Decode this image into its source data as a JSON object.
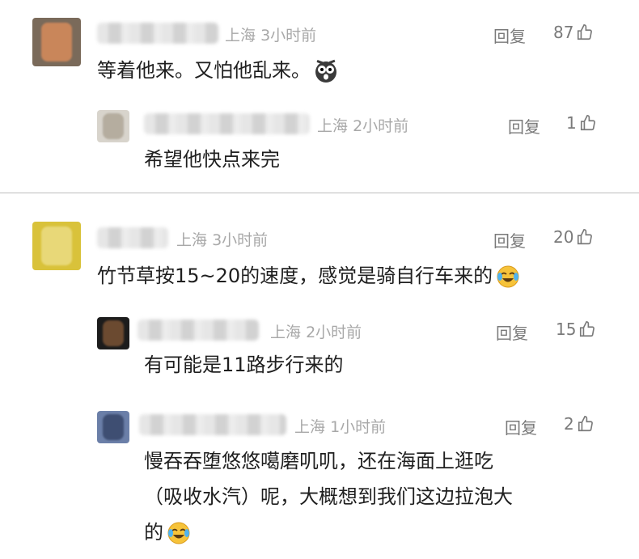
{
  "comments": [
    {
      "location": "上海",
      "time": "3小时前",
      "reply_label": "回复",
      "likes": "87",
      "text": "等着他来。又怕他乱来。",
      "emoji": "shocked-emoji",
      "replies": [
        {
          "location": "上海",
          "time": "2小时前",
          "reply_label": "回复",
          "likes": "1",
          "text": "希望他快点来完"
        }
      ]
    },
    {
      "location": "上海",
      "time": "3小时前",
      "reply_label": "回复",
      "likes": "20",
      "text": "竹节草按15~20的速度，感觉是骑自行车来的",
      "emoji": "laugh-cry-emoji",
      "replies": [
        {
          "location": "上海",
          "time": "2小时前",
          "reply_label": "回复",
          "likes": "15",
          "text": "有可能是11路步行来的"
        },
        {
          "location": "上海",
          "time": "1小时前",
          "reply_label": "回复",
          "likes": "2",
          "text_line1": "慢吞吞堕悠悠噶磨叽叽，还在海面上逛吃",
          "text_line2": "（吸收水汽）呢，大概想到我们这边拉泡大",
          "text_line3": "的",
          "emoji": "laugh-cry-emoji"
        }
      ]
    }
  ]
}
